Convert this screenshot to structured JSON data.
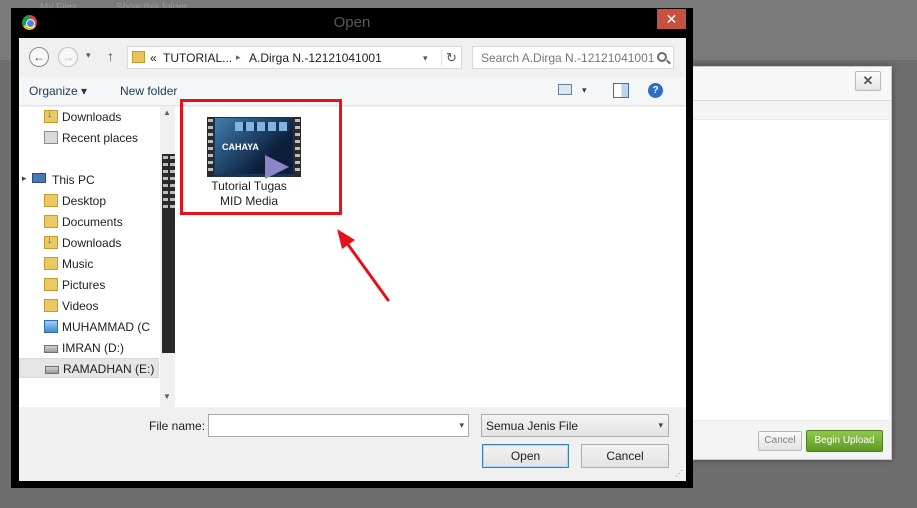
{
  "background_app": {
    "left_text": "My Files",
    "mid_text": "Show this folder"
  },
  "upload_modal": {
    "close_label": "✕",
    "cancel_label": "Cancel",
    "begin_upload_label": "Begin Upload",
    "accent_color": "#6aa832"
  },
  "dialog": {
    "title": "Open",
    "close_label": "✕",
    "nav": {
      "back": "←",
      "forward": "→",
      "history": "▾",
      "up": "↑"
    },
    "address": {
      "prefix": "«",
      "segment1": "TUTORIAL...",
      "segment2": "A.Dirga N.-12121041001",
      "refresh": "↻"
    },
    "search_placeholder": "Search A.Dirga N.-12121041001",
    "toolbar": {
      "organize": "Organize ▾",
      "new_folder": "New folder",
      "view_drop": "▾",
      "help": "?"
    },
    "sidebar": {
      "items": [
        {
          "label": "Downloads",
          "icon": "downloads-folder-icon"
        },
        {
          "label": "Recent places",
          "icon": "recent-places-icon"
        },
        {
          "label": "This PC",
          "icon": "computer-icon"
        },
        {
          "label": "Desktop",
          "icon": "folder-icon"
        },
        {
          "label": "Documents",
          "icon": "folder-icon"
        },
        {
          "label": "Downloads",
          "icon": "downloads-folder-icon"
        },
        {
          "label": "Music",
          "icon": "folder-icon"
        },
        {
          "label": "Pictures",
          "icon": "folder-icon"
        },
        {
          "label": "Videos",
          "icon": "folder-icon"
        },
        {
          "label": "MUHAMMAD (C",
          "icon": "windows-drive-icon"
        },
        {
          "label": "IMRAN (D:)",
          "icon": "drive-icon"
        },
        {
          "label": "RAMADHAN (E:)",
          "icon": "drive-icon"
        }
      ],
      "expander": "▸"
    },
    "files": [
      {
        "name_line1": "Tutorial Tugas",
        "name_line2": "MID Media",
        "thumb_text": "CAHAYA"
      }
    ],
    "bottom": {
      "file_name_label": "File name:",
      "file_name_value": "",
      "file_type": "Semua Jenis File",
      "open_label": "Open",
      "cancel_label": "Cancel"
    },
    "annotation_color": "#e8111a"
  }
}
